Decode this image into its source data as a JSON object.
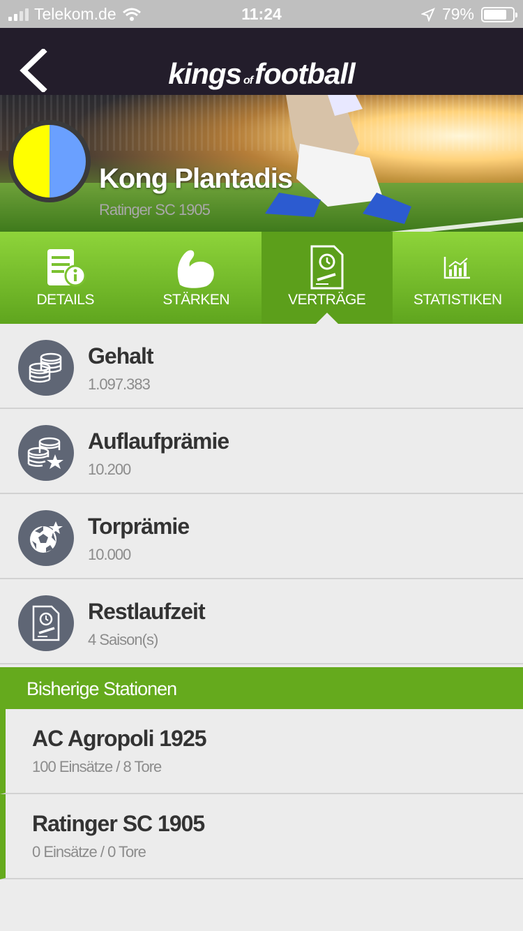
{
  "status_bar": {
    "carrier": "Telekom.de",
    "time": "11:24",
    "battery": "79%"
  },
  "header": {
    "logo_main": "kings",
    "logo_of": "of",
    "logo_end": "football"
  },
  "player": {
    "name": "Kong Plantadis",
    "club": "Ratinger SC 1905"
  },
  "tabs": [
    {
      "label": "DETAILS",
      "icon": "details-icon"
    },
    {
      "label": "STÄRKEN",
      "icon": "strength-icon"
    },
    {
      "label": "VERTRÄGE",
      "icon": "contract-icon",
      "active": true
    },
    {
      "label": "STATISTIKEN",
      "icon": "stats-icon"
    }
  ],
  "contract": [
    {
      "title": "Gehalt",
      "value": "1.097.383",
      "icon": "coins-icon"
    },
    {
      "title": "Auflaufprämie",
      "value": "10.200",
      "icon": "coins-star-icon"
    },
    {
      "title": "Torprämie",
      "value": "10.000",
      "icon": "ball-star-icon"
    },
    {
      "title": "Restlaufzeit",
      "value": "4 Saison(s)",
      "icon": "contract-clock-icon"
    }
  ],
  "stations_header": "Bisherige Stationen",
  "stations": [
    {
      "club": "AC Agropoli 1925",
      "stats": "100 Einsätze / 8 Tore"
    },
    {
      "club": "Ratinger SC 1905",
      "stats": "0 Einsätze / 0 Tore"
    }
  ],
  "colors": {
    "green": "#65aa1d",
    "dark": "#231d2b",
    "crest_left": "#ffff00",
    "crest_right": "#6aa0ff"
  }
}
